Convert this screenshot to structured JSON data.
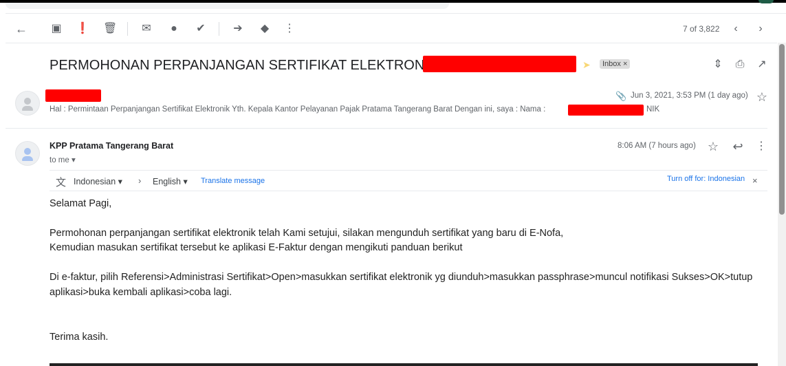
{
  "toolbar": {
    "back": "arrow-left-icon",
    "counter": "7 of 3,822"
  },
  "thread": {
    "subject": "PERMOHONAN PERPANJANGAN SERTIFIKAT ELEKTRONIK PT.",
    "label": "Inbox",
    "label_close": "×"
  },
  "msg1": {
    "snippet": "Hal : Permintaan Perpanjangan Sertifikat Elektronik Yth. Kepala Kantor Pelayanan Pajak Pratama Tangerang Barat Dengan ini, saya : Nama :",
    "snippet_tail": "NIK",
    "date": "Jun 3, 2021, 3:53 PM (1 day ago)"
  },
  "msg2": {
    "sender": "KPP Pratama Tangerang Barat",
    "to": "to me",
    "date": "8:06 AM (7 hours ago)"
  },
  "translate": {
    "from": "Indonesian",
    "to": "English",
    "action": "Translate message",
    "turn_off": "Turn off for: Indonesian",
    "close": "×"
  },
  "body": {
    "lines": [
      "Selamat Pagi,",
      "Permohonan perpanjangan sertifikat elektronik telah Kami setujui, silakan mengunduh sertifikat yang baru di E-Nofa,",
      "Kemudian masukan sertifikat tersebut ke aplikasi E-Faktur dengan mengikuti panduan berikut",
      "Di e-faktur, pilih Referensi>Administrasi Sertifikat>Open>masukkan sertifikat elektronik yg diunduh>masukkan passphrase>muncul notifikasi Sukses>OK>tutup",
      "aplikasi>buka kembali aplikasi>coba lagi.",
      "Terima kasih."
    ]
  },
  "colors": {
    "link": "#1a73e8",
    "redaction": "#ff0000",
    "important": "#f8d775"
  }
}
